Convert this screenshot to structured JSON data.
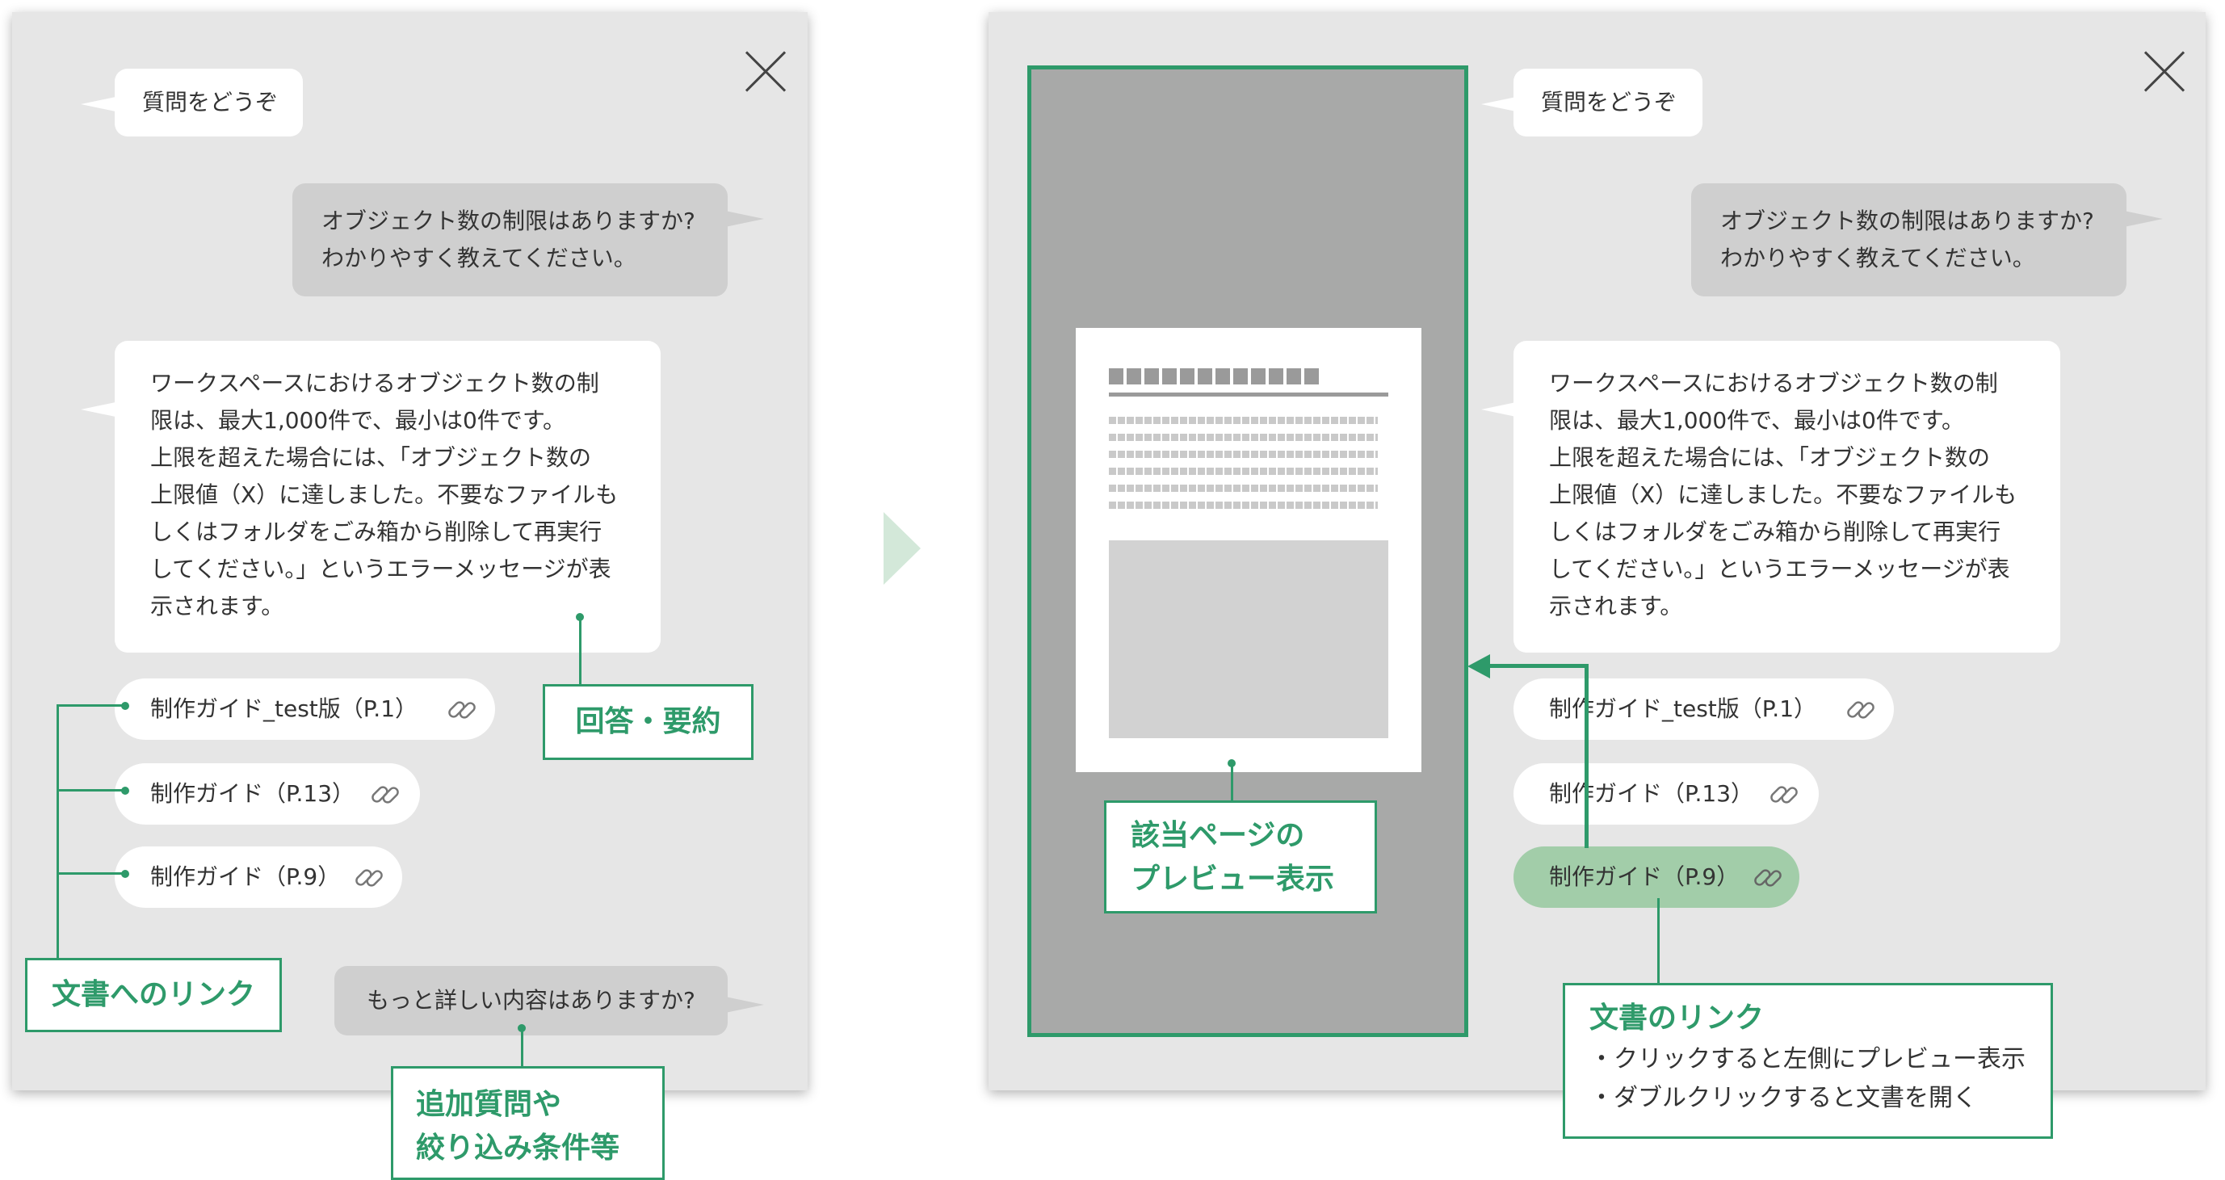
{
  "left_panel": {
    "greeting": "質問をどうぞ",
    "question_lines": [
      "オブジェクト数の制限はありますか?",
      "わかりやすく教えてください。"
    ],
    "answer_lines": [
      "ワークスペースにおけるオブジェクト数の制",
      "限は、最大1,000件で、最小は0件です。",
      "上限を超えた場合には、「オブジェクト数の",
      "上限値（X）に達しました。不要なファイルも",
      "しくはフォルダをごみ箱から削除して再実行",
      "してください。」というエラーメッセージが表",
      "示されます。"
    ],
    "links": [
      "制作ガイド_test版（P.1）",
      "制作ガイド（P.13）",
      "制作ガイド（P.9）"
    ],
    "followup": "もっと詳しい内容はありますか?"
  },
  "right_panel": {
    "greeting": "質問をどうぞ",
    "question_lines": [
      "オブジェクト数の制限はありますか?",
      "わかりやすく教えてください。"
    ],
    "answer_lines": [
      "ワークスペースにおけるオブジェクト数の制",
      "限は、最大1,000件で、最小は0件です。",
      "上限を超えた場合には、「オブジェクト数の",
      "上限値（X）に達しました。不要なファイルも",
      "しくはフォルダをごみ箱から削除して再実行",
      "してください。」というエラーメッセージが表",
      "示されます。"
    ],
    "links": [
      "制作ガイド_test版（P.1）",
      "制作ガイド（P.13）",
      "制作ガイド（P.9）"
    ]
  },
  "callouts": {
    "answer_summary": "回答・要約",
    "doc_links": "文書へのリンク",
    "followup_lines": [
      "追加質問や",
      "絞り込み条件等"
    ],
    "preview_lines": [
      "該当ページの",
      "プレビュー表示"
    ],
    "doc_link_title": "文書のリンク",
    "doc_link_notes": [
      "・クリックすると左側にプレビュー表示",
      "・ダブルクリックすると文書を開く"
    ]
  },
  "colors": {
    "accent_green": "#2e9a6a",
    "active_link": "#a2cda9",
    "panel_bg": "#e6e6e6",
    "preview_bg": "#a8a9a8"
  },
  "icons": [
    "close-icon",
    "link-icon",
    "next-arrow-icon"
  ]
}
